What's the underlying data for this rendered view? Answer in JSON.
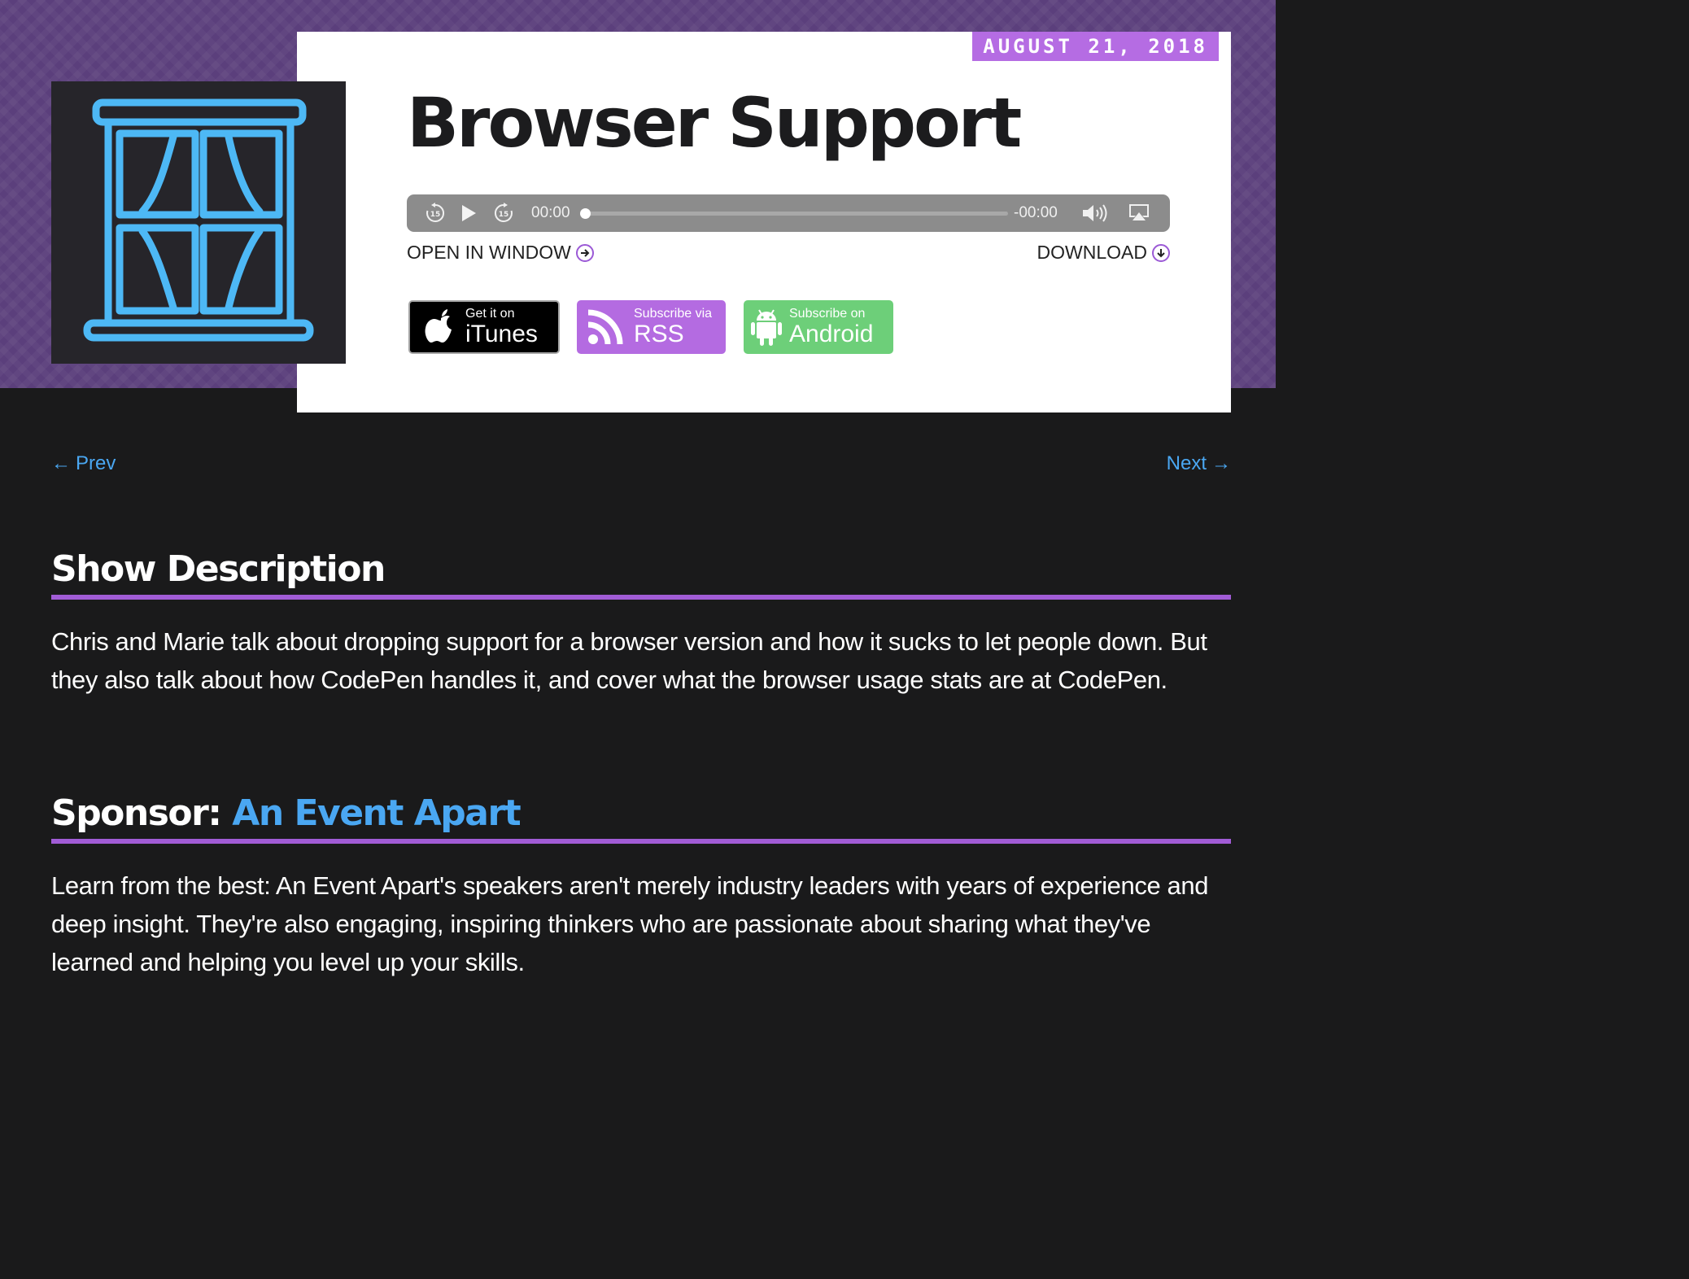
{
  "episode": {
    "date": "AUGUST 21, 2018",
    "title": "Browser Support"
  },
  "player": {
    "current_time": "00:00",
    "remaining_time": "-00:00",
    "progress": 0,
    "skip_back_seconds": "15",
    "skip_forward_seconds": "15"
  },
  "links": {
    "open_in_window": "OPEN IN WINDOW",
    "download": "DOWNLOAD"
  },
  "subscribe": {
    "itunes_small": "Get it on",
    "itunes_big": "iTunes",
    "rss_small": "Subscribe via",
    "rss_big": "RSS",
    "android_small": "Subscribe on",
    "android_big": "Android"
  },
  "nav": {
    "prev": "Prev",
    "next": "Next",
    "prev_arrow": "←",
    "next_arrow": "→"
  },
  "show_description": {
    "heading": "Show Description",
    "text": "Chris and Marie talk about dropping support for a browser version and how it sucks to let people down. But they also talk about how CodePen handles it, and cover what the browser usage stats are at CodePen."
  },
  "sponsor": {
    "heading_prefix": "Sponsor: ",
    "name": "An Event Apart",
    "text": "Learn from the best: An Event Apart's speakers aren't merely industry leaders with years of experience and deep insight. They're also engaging, inspiring thinkers who are passionate about sharing what they've learned and helping you level up your skills."
  },
  "colors": {
    "hero_purple": "#5b3f7c",
    "accent_purple": "#a15cd6",
    "link_blue": "#4aa7f2",
    "window_icon_blue": "#4db8f5",
    "page_bg": "#1a1a1b"
  },
  "icons": {
    "artwork": "window-curtains-icon",
    "rewind": "rewind-15-icon",
    "play": "play-icon",
    "forward": "forward-15-icon",
    "volume": "volume-icon",
    "airplay": "airplay-icon",
    "open_window": "arrow-right-circle-icon",
    "download": "arrow-down-circle-icon",
    "itunes": "apple-icon",
    "rss": "rss-icon",
    "android": "android-icon"
  }
}
